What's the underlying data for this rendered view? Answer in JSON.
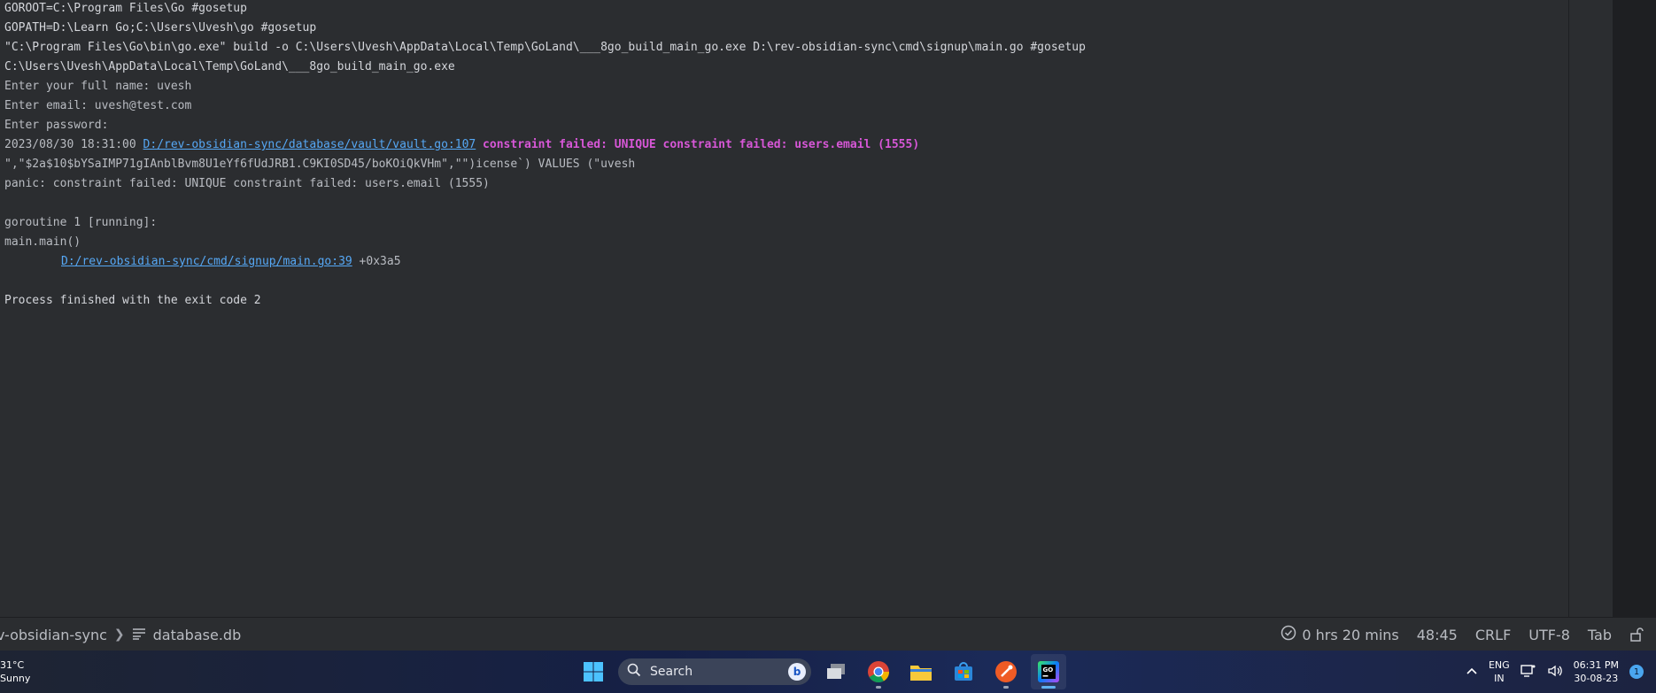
{
  "console": {
    "lines": {
      "goroot": "GOROOT=C:\\Program Files\\Go #gosetup",
      "gopath": "GOPATH=D:\\Learn Go;C:\\Users\\Uvesh\\go #gosetup",
      "build_cmd": "\"C:\\Program Files\\Go\\bin\\go.exe\" build -o C:\\Users\\Uvesh\\AppData\\Local\\Temp\\GoLand\\___8go_build_main_go.exe D:\\rev-obsidian-sync\\cmd\\signup\\main.go #gosetup",
      "exe_path": "C:\\Users\\Uvesh\\AppData\\Local\\Temp\\GoLand\\___8go_build_main_go.exe",
      "prompt_name": "Enter your full name: uvesh",
      "prompt_email": "Enter email: uvesh@test.com",
      "prompt_password": "Enter password:",
      "log_timestamp": "2023/08/30 18:31:00 ",
      "log_link": "D:/rev-obsidian-sync/database/vault/vault.go:107",
      "log_error": " constraint failed: UNIQUE constraint failed: users.email (1555)",
      "sql_fragment": "\",\"$2a$10$bYSaIMP71gIAnblBvm8U1eYf6fUdJRB1.C9KI0SD45/boKOiQkVHm\",\"\")icense`) VALUES (\"uvesh",
      "panic": "panic: constraint failed: UNIQUE constraint failed: users.email (1555)",
      "goroutine": "goroutine 1 [running]:",
      "main_main": "main.main()",
      "trace_link": "D:/rev-obsidian-sync/cmd/signup/main.go:39",
      "trace_offset": " +0x3a5",
      "exit": "Process finished with the exit code 2"
    }
  },
  "status_bar": {
    "breadcrumb_project": "v-obsidian-sync",
    "breadcrumb_file": "database.db",
    "timer": "0 hrs 20 mins",
    "cursor_position": "48:45",
    "line_separator": "CRLF",
    "encoding": "UTF-8",
    "indent": "Tab"
  },
  "taskbar": {
    "weather_temp": "31°C",
    "weather_desc": "Sunny",
    "search_placeholder": "Search",
    "language_top": "ENG",
    "language_bottom": "IN",
    "time": "06:31 PM",
    "date": "30-08-23",
    "notification_count": "1"
  },
  "colors": {
    "link": "#56a8f5",
    "error": "#d757d7",
    "accent": "#5fb2f2"
  }
}
